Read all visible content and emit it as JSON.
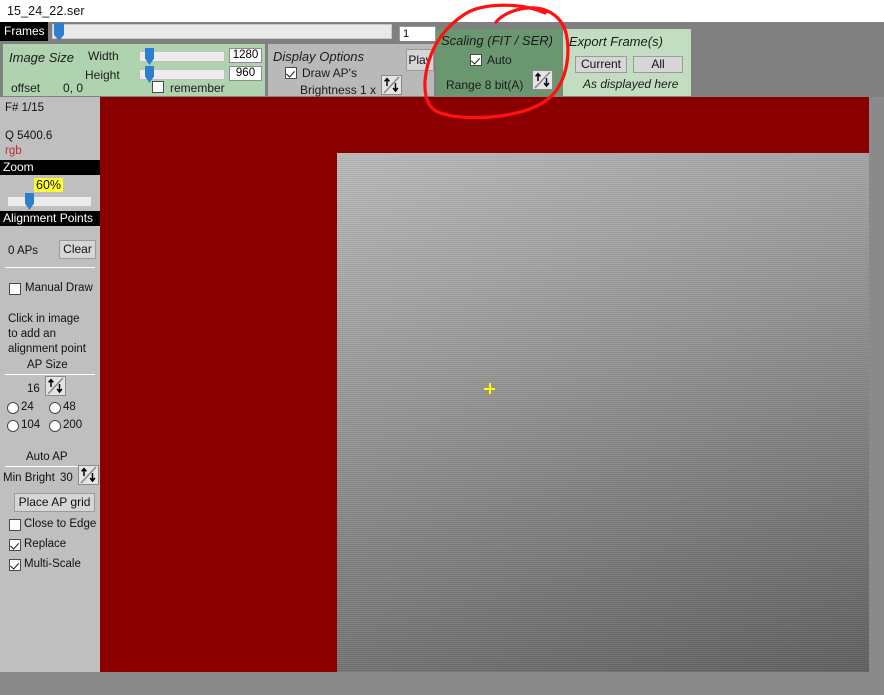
{
  "window": {
    "title": "15_24_22.ser"
  },
  "frames": {
    "label": "Frames",
    "current_frame": "1",
    "slider_position_pct": 1
  },
  "image_size": {
    "title": "Image Size",
    "width_label": "Width",
    "height_label": "Height",
    "width_value": "1280",
    "height_value": "960",
    "offset_label": "offset",
    "offset_value": "0, 0",
    "remember_label": "remember",
    "remember_checked": false
  },
  "display_options": {
    "title": "Display Options",
    "draw_aps_label": "Draw AP's",
    "draw_aps_checked": true,
    "brightness_label": "Brightness 1 x",
    "brightness_spinner": "spinner-icon",
    "play_label": "Play"
  },
  "scaling": {
    "title": "Scaling (FIT / SER)",
    "auto_label": "Auto",
    "auto_checked": true,
    "range_label": "Range 8 bit(A)",
    "range_spinner": "spinner-icon"
  },
  "export": {
    "title": "Export Frame(s)",
    "current_label": "Current",
    "all_label": "All",
    "note": "As displayed here"
  },
  "sidebar": {
    "frame_counter": "F# 1/15",
    "quality_label": "Q  5400.6",
    "color_mode": "rgb",
    "zoom": {
      "header": "Zoom",
      "value": "60%",
      "slider_position_pct": 30
    },
    "alignment_points": {
      "header": "Alignment Points",
      "count_label": "0 APs",
      "clear_label": "Clear",
      "manual_draw_label": "Manual Draw",
      "manual_draw_checked": false,
      "hint_line1": "Click in image",
      "hint_line2": "to add an",
      "hint_line3": "alignment point"
    },
    "ap_size": {
      "header": "AP Size",
      "value": "16",
      "spinner": "spinner-icon",
      "options": [
        {
          "label": "24",
          "selected": false
        },
        {
          "label": "48",
          "selected": false
        },
        {
          "label": "104",
          "selected": false
        },
        {
          "label": "200",
          "selected": false
        }
      ]
    },
    "auto_ap": {
      "header": "Auto AP",
      "min_bright_label": "Min Bright",
      "min_bright_value": "30",
      "spinner": "spinner-icon",
      "place_grid_label": "Place AP grid",
      "close_to_edge_label": "Close to Edge",
      "close_to_edge_checked": false,
      "replace_label": "Replace",
      "replace_checked": true,
      "multi_scale_label": "Multi-Scale",
      "multi_scale_checked": true
    }
  },
  "canvas": {
    "background_color": "#8a0000",
    "crosshair_marker": "alignment-crosshair"
  },
  "annotation": {
    "color": "#ff1111",
    "shape": "hand-drawn-ellipse-around-scaling-panel"
  },
  "colors": {
    "panel_green_light": "#aed3ae",
    "panel_green_dark": "#6b9770",
    "panel_green_pale": "#c3ddc0",
    "chrome_gray": "#808080",
    "sidebar_gray": "#bfbfbf",
    "canvas_red": "#8a0000",
    "highlight_yellow": "#ffff33",
    "slider_blue": "#2f7fd0"
  }
}
